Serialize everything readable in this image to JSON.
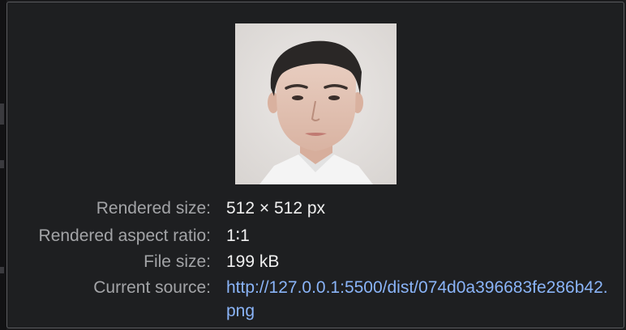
{
  "image_preview": {
    "alt": ""
  },
  "info": {
    "rendered_size": {
      "label": "Rendered size:",
      "value": "512 × 512 px"
    },
    "aspect_ratio": {
      "label": "Rendered aspect ratio:",
      "value": "1∶1"
    },
    "file_size": {
      "label": "File size:",
      "value": "199 kB"
    },
    "current_source": {
      "label": "Current source:",
      "value": "http://127.0.0.1:5500/dist/074d0a396683fe286b42.png"
    }
  },
  "colors": {
    "background": "#1e1f21",
    "label": "#a3a4a7",
    "value": "#f0f0f0",
    "link": "#8ab4f8"
  }
}
